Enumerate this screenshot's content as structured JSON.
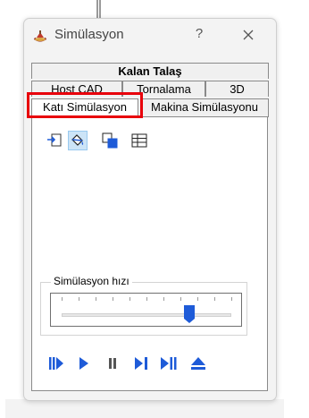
{
  "window": {
    "title": "Simülasyon",
    "help_label": "?",
    "close_label": "✕"
  },
  "tabs": {
    "row1": [
      {
        "label": "Kalan Talaş"
      }
    ],
    "row2": [
      {
        "label": "Host CAD"
      },
      {
        "label": "Tornalama"
      },
      {
        "label": "3D"
      }
    ],
    "row3": [
      {
        "label": "Katı Simülasyon",
        "selected": true,
        "highlighted": true
      },
      {
        "label": "Makina Simülasyonu"
      }
    ]
  },
  "toolbar": {
    "icons": [
      "import-icon",
      "paint-bucket-icon",
      "layers-icon",
      "table-icon"
    ],
    "active_index": 1
  },
  "speed": {
    "label": "Simülasyon hızı",
    "value_fraction": 0.75
  },
  "playback": {
    "icons": [
      "step-play-icon",
      "play-icon",
      "pause-icon",
      "step-next-icon",
      "skip-to-end-icon",
      "eject-icon"
    ]
  },
  "colors": {
    "accent_blue": "#1e5bd8",
    "highlight_red": "#e8000b"
  }
}
